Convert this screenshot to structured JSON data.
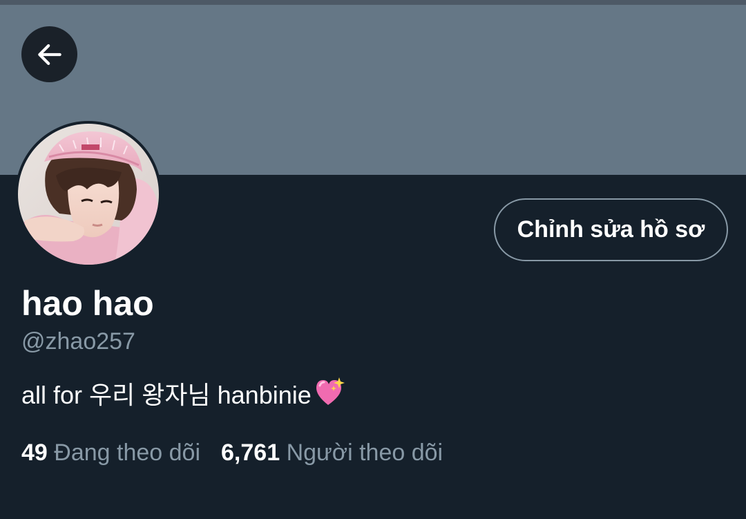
{
  "header": {
    "back_icon": "arrow-left-icon",
    "banner_color": "#657786"
  },
  "profile": {
    "avatar_icon": "profile-avatar-photo",
    "display_name": "hao hao",
    "handle": "@zhao257",
    "bio": "all for 우리 왕자님 hanbinie",
    "bio_emoji": "sparkling-heart-emoji",
    "edit_button_label": "Chỉnh sửa hồ sơ"
  },
  "stats": {
    "following_count": "49",
    "following_label": "Đang theo dõi",
    "followers_count": "6,761",
    "followers_label": "Người theo dõi"
  },
  "colors": {
    "background": "#15202b",
    "secondary_text": "#8899a6",
    "primary_text": "#ffffff"
  }
}
